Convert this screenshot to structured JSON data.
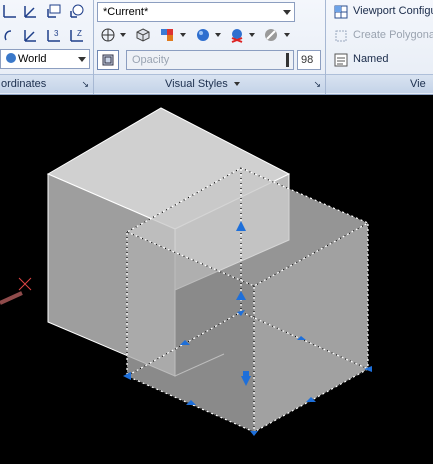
{
  "coordinates_panel": {
    "ucs_combo_value": "World",
    "panel_label": "ordinates"
  },
  "visual_styles_panel": {
    "style_combo_value": "*Current*",
    "opacity_placeholder": "Opacity",
    "opacity_value": "98",
    "panel_label": "Visual Styles"
  },
  "viewports_panel": {
    "viewport_config_label": "Viewport Configu",
    "create_polygonal_label": "Create Polygona",
    "named_label": "Named",
    "panel_label": "Vie"
  },
  "colors": {
    "ribbon_bg": "#e6ecf5",
    "viewport_bg": "#000000",
    "solid_face_light": "#c9c9c9",
    "solid_face_mid": "#b3b3b3",
    "grip_blue": "#1e6fd9"
  },
  "icons": [
    "ucs-icon",
    "ucs-view-icon",
    "ucs-object-icon",
    "ucs-face-icon",
    "ucs-origin-icon",
    "ucs-z-icon",
    "ucs-3point-icon",
    "ucs-x-icon",
    "edge-effects-icon",
    "face-style-icon",
    "shadows-icon",
    "material-icon",
    "texture-icon",
    "lighting-icon",
    "xray-icon",
    "viewport-config-icon",
    "create-polygon-icon",
    "named-viewports-icon"
  ]
}
